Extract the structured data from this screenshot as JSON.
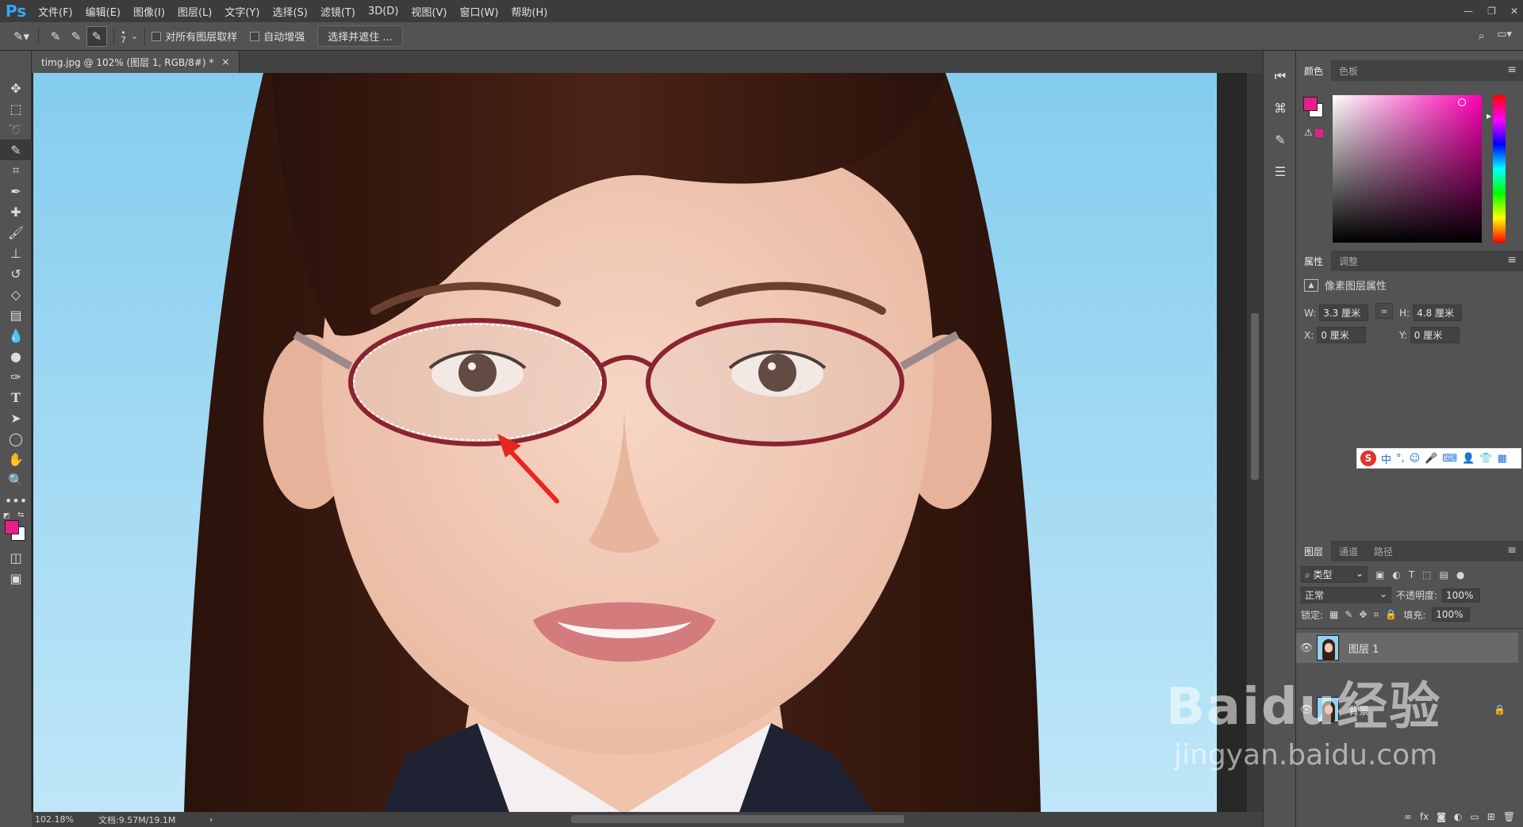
{
  "app": {
    "logo": "Ps"
  },
  "menu": [
    "文件(F)",
    "编辑(E)",
    "图像(I)",
    "图层(L)",
    "文字(Y)",
    "选择(S)",
    "滤镜(T)",
    "3D(D)",
    "视图(V)",
    "窗口(W)",
    "帮助(H)"
  ],
  "options": {
    "brush_size": "7",
    "sample_all_label": "对所有图层取样",
    "auto_enhance_label": "自动增强",
    "select_mask_label": "选择并遮住 ..."
  },
  "document": {
    "tab_title": "timg.jpg @ 102% (图层 1, RGB/8#) *",
    "close": "×"
  },
  "status": {
    "zoom": "102.18%",
    "doc_size": "文档:9.57M/19.1M",
    "arrow": "›"
  },
  "color_panel": {
    "tabs": [
      "颜色",
      "色板"
    ],
    "foreground": "#e91e8c",
    "background": "#ffffff"
  },
  "properties_panel": {
    "tabs": [
      "属性",
      "调整"
    ],
    "title": "像素图层属性",
    "w_label": "W:",
    "w_value": "3.3 厘米",
    "h_label": "H:",
    "h_value": "4.8 厘米",
    "x_label": "X:",
    "x_value": "0 厘米",
    "y_label": "Y:",
    "y_value": "0 厘米"
  },
  "ime": {
    "lang": "中"
  },
  "layers_panel": {
    "tabs": [
      "图层",
      "通道",
      "路径"
    ],
    "filter_label": "类型",
    "blend_mode": "正常",
    "opacity_label": "不透明度:",
    "opacity_value": "100%",
    "lock_label": "锁定:",
    "fill_label": "填充:",
    "fill_value": "100%",
    "layers": [
      {
        "name": "图层 1"
      },
      {
        "name": "背景"
      }
    ]
  },
  "watermark": {
    "brand": "Baidu经验",
    "url": "jingyan.baidu.com"
  }
}
